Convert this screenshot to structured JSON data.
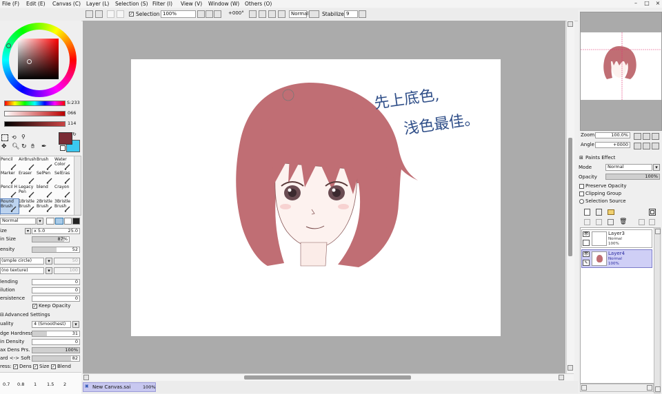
{
  "menu": [
    "File (F)",
    "Edit (E)",
    "Canvas (C)",
    "Layer (L)",
    "Selection (S)",
    "Filter (I)",
    "View (V)",
    "Window (W)",
    "Others (O)"
  ],
  "window_buttons": [
    "–",
    "□",
    "×"
  ],
  "toolbar": {
    "selection_label": "Selection",
    "zoom": "100%",
    "rotation": "+000°",
    "blend_mode": "Normal",
    "stabilizer_label": "Stabilizer",
    "stabilizer_value": "9"
  },
  "colors": {
    "hsv_s": "S:233",
    "slider2_value": "066",
    "slider3_value": "114",
    "primary": "#7a2c35",
    "secondary": "#3bc8f0",
    "hair": "#c06e74"
  },
  "tools": [
    {
      "name": "Pencil",
      "icon": "pencil-icon"
    },
    {
      "name": "AirBrush",
      "icon": "airbrush-icon"
    },
    {
      "name": "Brush",
      "icon": "brush-icon"
    },
    {
      "name": "Water Color",
      "icon": "watercolor-icon"
    },
    {
      "name": "Marker",
      "icon": "marker-icon"
    },
    {
      "name": "Eraser",
      "icon": "eraser-icon"
    },
    {
      "name": "SelPen",
      "icon": "selpen-icon"
    },
    {
      "name": "SelEras",
      "icon": "seleras-icon"
    },
    {
      "name": "Pencil H",
      "icon": "pencil-h-icon"
    },
    {
      "name": "Legacy Pen",
      "icon": "legacy-pen-icon"
    },
    {
      "name": "blend",
      "icon": "blend-icon"
    },
    {
      "name": "Crayon",
      "icon": "crayon-icon"
    },
    {
      "name": "Round Brush",
      "icon": "round-brush-icon"
    },
    {
      "name": "1Bristle Brush",
      "icon": "bristle1-icon"
    },
    {
      "name": "2Bristle Brush",
      "icon": "bristle2-icon"
    },
    {
      "name": "3Bristle Brush",
      "icon": "bristle3-icon"
    }
  ],
  "brush": {
    "mode": "Normal",
    "size_label": "ize",
    "size_mult": "x 5.0",
    "size_value": "25.0",
    "min_size_label": "in Size",
    "min_size_value": "87%",
    "density_label": "ensity",
    "density_value": "52",
    "shape": "(smple circle)",
    "shape_value": "50",
    "texture": "(no texture)",
    "texture_value": "100",
    "blending_label": "lending",
    "blending_value": "0",
    "dilution_label": "ilution",
    "dilution_value": "0",
    "persistence_label": "ersistence",
    "persistence_value": "0",
    "keep_opacity": "Keep Opacity",
    "advanced_settings": "Advanced Settings",
    "quality_label": "uality",
    "quality_value": "4 (Smoothest)",
    "edge_hardness_label": "dge Hardness",
    "edge_hardness_value": "31",
    "min_density_label": "in Density",
    "min_density_value": "0",
    "max_dens_label": "ax Dens Prs.",
    "max_dens_value": "100%",
    "hard_soft_label": "ard <-> Soft",
    "hard_soft_value": "82",
    "press_label": "ress:",
    "press_dens": "Dens",
    "press_size": "Size",
    "press_blend": "Blend",
    "preset_sizes": [
      "0.7",
      "0.8",
      "1",
      "1.5",
      "2"
    ]
  },
  "canvas": {
    "annotation_line1": "先上底色,",
    "annotation_line2": "浅色最佳。"
  },
  "tab": {
    "name": "New Canvas.sai",
    "zoom": "100%"
  },
  "navigator": {
    "zoom_label": "Zoom",
    "zoom_value": "100.0%",
    "angle_label": "Angle",
    "angle_value": "+0000"
  },
  "layer_panel": {
    "paints_effect": "Paints Effect",
    "mode_label": "Mode",
    "mode_value": "Normal",
    "opacity_label": "Opacity",
    "opacity_value": "100%",
    "preserve_opacity": "Preserve Opacity",
    "clipping_group": "Clipping Group",
    "selection_source": "Selection Source",
    "layers": [
      {
        "name": "Layer3",
        "mode": "Normal",
        "opacity": "100%"
      },
      {
        "name": "Layer4",
        "mode": "Normal",
        "opacity": "100%"
      }
    ]
  }
}
